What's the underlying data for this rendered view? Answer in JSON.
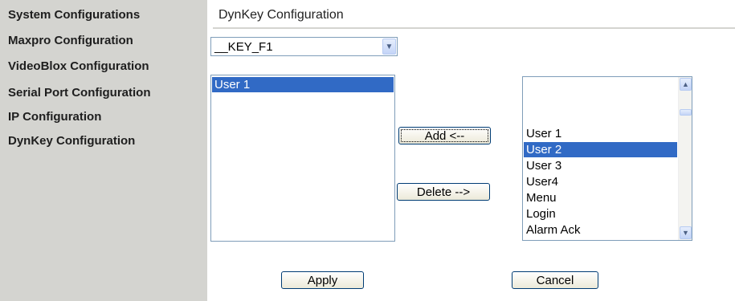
{
  "sidebar": {
    "items": [
      {
        "label": "System Configurations"
      },
      {
        "label": "Maxpro Configuration"
      },
      {
        "label": "VideoBlox Configuration"
      },
      {
        "label": "Serial Port Configuration"
      },
      {
        "label": "IP Configuration"
      },
      {
        "label": "DynKey Configuration"
      }
    ]
  },
  "main": {
    "title": "DynKey Configuration",
    "key_select": {
      "value": "__KEY_F1"
    },
    "assigned_list": {
      "items": [
        {
          "label": "User 1",
          "selected": true
        }
      ]
    },
    "available_list": {
      "items": [
        {
          "label": "User 1",
          "selected": false
        },
        {
          "label": "User 2",
          "selected": true
        },
        {
          "label": "User 3",
          "selected": false
        },
        {
          "label": "User4",
          "selected": false
        },
        {
          "label": "Menu",
          "selected": false
        },
        {
          "label": "Login",
          "selected": false
        },
        {
          "label": "Alarm Ack",
          "selected": false
        }
      ]
    },
    "add_button": "Add <--",
    "delete_button": "Delete -->",
    "apply_button": "Apply",
    "cancel_button": "Cancel"
  },
  "icons": {
    "dropdown": "chevron-down-icon",
    "scroll_up": "scroll-up-icon",
    "scroll_down": "scroll-down-icon"
  },
  "colors": {
    "sidebar_bg": "#d4d4d0",
    "selection": "#316ac5",
    "field_border": "#7f9db9"
  }
}
